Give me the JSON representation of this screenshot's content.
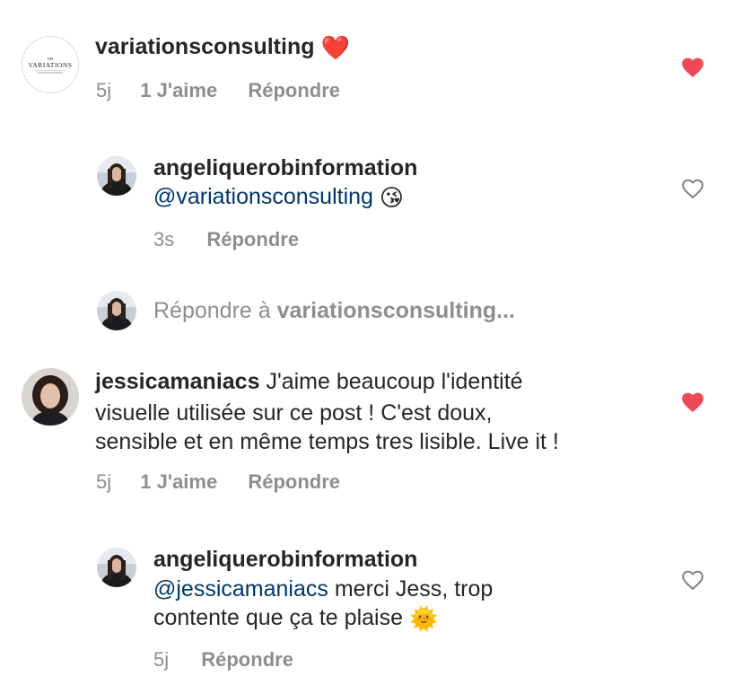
{
  "colors": {
    "accent_heart": "#ed4956",
    "muted": "#8e8e8e",
    "mention": "#00376b"
  },
  "comments": [
    {
      "username": "variationsconsulting",
      "text_emoji": "❤️",
      "logo_text": "VARIATIONS",
      "time": "5j",
      "likes": "1 J'aime",
      "reply_label": "Répondre",
      "liked": true
    },
    {
      "username": "angeliquerobinformation",
      "mention": "@variationsconsulting",
      "text_emoji": "😘",
      "time": "3s",
      "reply_label": "Répondre",
      "liked": false
    },
    {
      "reply_prompt_prefix": "Répondre à",
      "reply_prompt_user": "variationsconsulting..."
    },
    {
      "username": "jessicamaniacs",
      "text_line1": "J'aime beaucoup l'identité",
      "text_line2": "visuelle utilisée sur ce post ! C'est doux,",
      "text_line3": "sensible et en même temps tres lisible. Live it !",
      "time": "5j",
      "likes": "1 J'aime",
      "reply_label": "Répondre",
      "liked": true
    },
    {
      "username": "angeliquerobinformation",
      "mention": "@jessicamaniacs",
      "text_line1": "merci Jess, trop",
      "text_line2": "contente que ça te plaise",
      "text_emoji": "🌞",
      "time": "5j",
      "reply_label": "Répondre",
      "liked": false
    }
  ]
}
